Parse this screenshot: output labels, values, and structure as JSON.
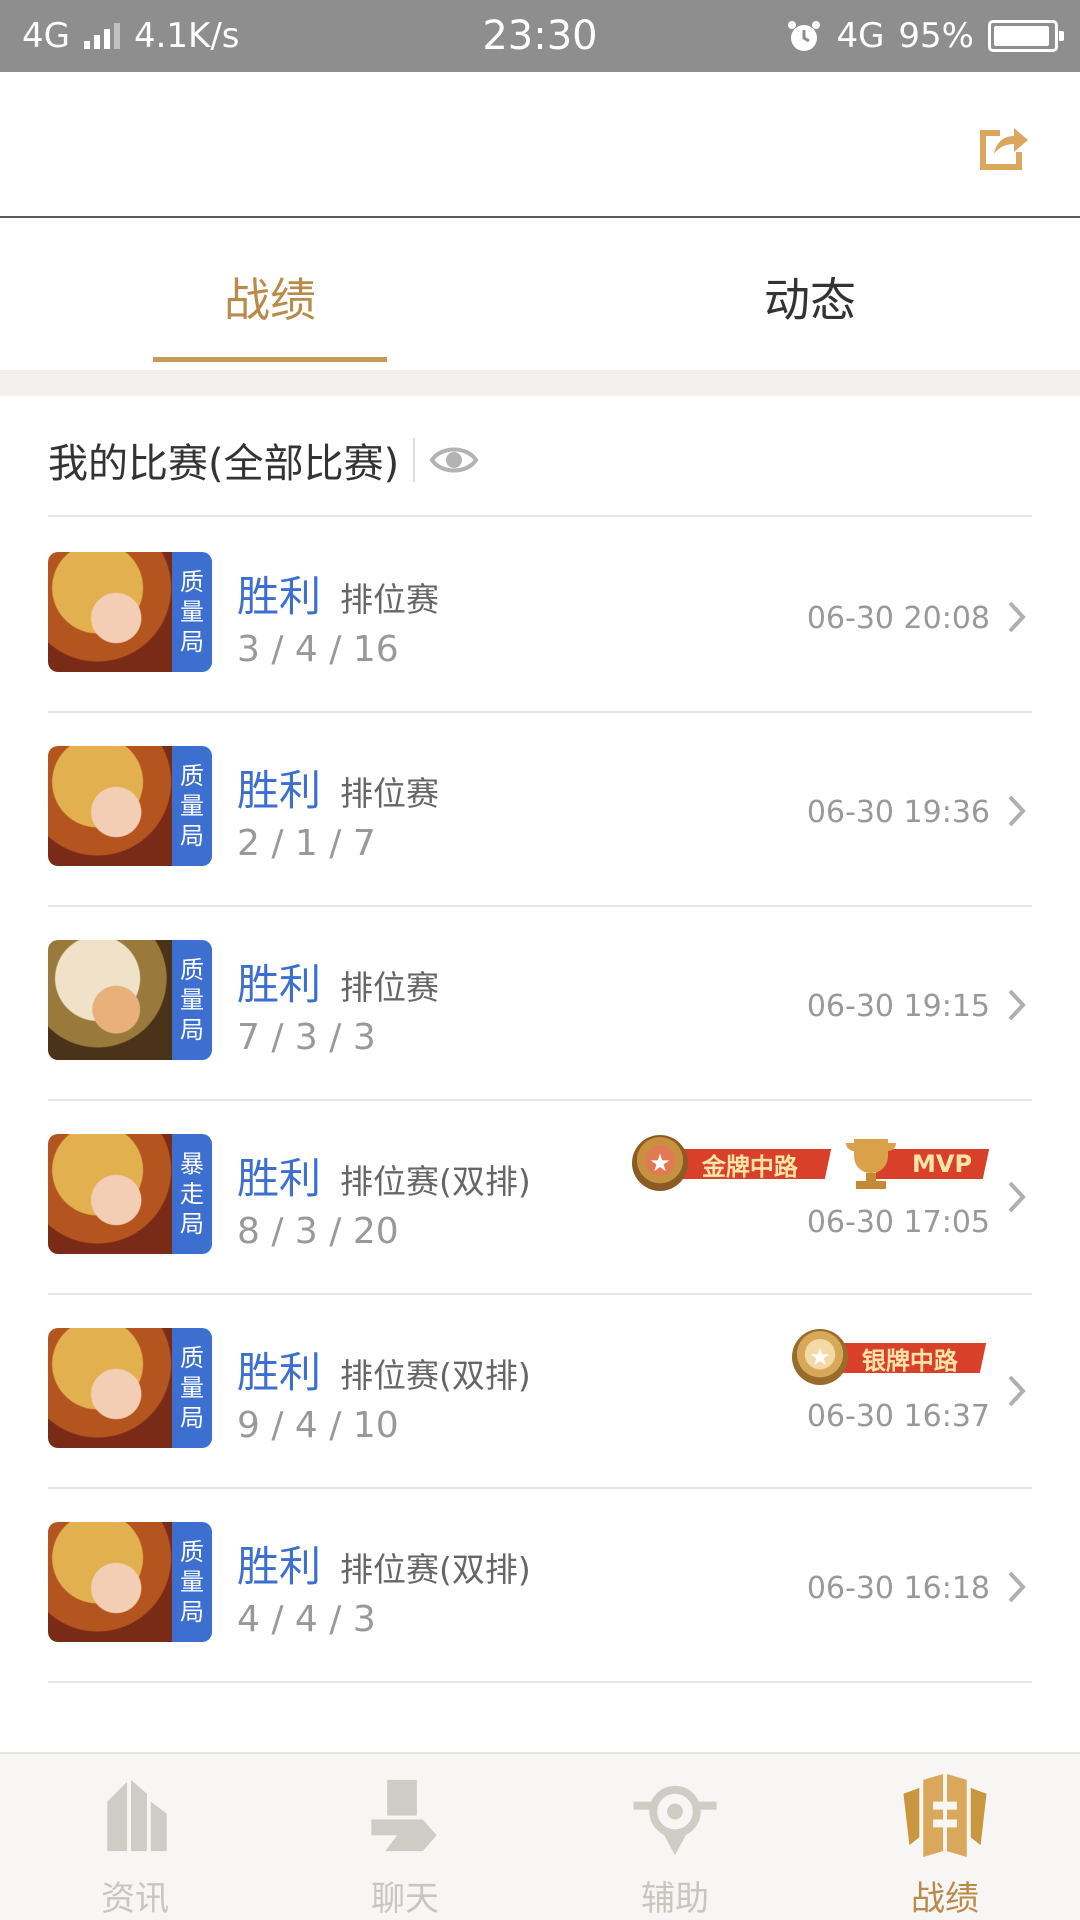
{
  "status_bar": {
    "network_left": "4G",
    "speed": "4.1K/s",
    "time": "23:30",
    "network_right": "4G",
    "battery": "95%",
    "battery_level": 0.95
  },
  "tabs": [
    {
      "label": "战绩",
      "active": true
    },
    {
      "label": "动态",
      "active": false
    }
  ],
  "section": {
    "title": "我的比赛(全部比赛)"
  },
  "matches": [
    {
      "hero_icon": "hero-girl",
      "tag": [
        "质",
        "量",
        "局"
      ],
      "result": "胜利",
      "mode": "排位赛",
      "kda": "3 / 4 / 16",
      "time": "06-30 20:08",
      "badges": []
    },
    {
      "hero_icon": "hero-girl",
      "tag": [
        "质",
        "量",
        "局"
      ],
      "result": "胜利",
      "mode": "排位赛",
      "kda": "2 / 1 / 7",
      "time": "06-30 19:36",
      "badges": []
    },
    {
      "hero_icon": "hero-warrior",
      "tag": [
        "质",
        "量",
        "局"
      ],
      "result": "胜利",
      "mode": "排位赛",
      "kda": "7 / 3 / 3",
      "time": "06-30 19:15",
      "badges": []
    },
    {
      "hero_icon": "hero-girl",
      "tag": [
        "暴",
        "走",
        "局"
      ],
      "result": "胜利",
      "mode": "排位赛(双排)",
      "kda": "8 / 3 / 20",
      "time": "06-30 17:05",
      "badges": [
        "金牌中路",
        "MVP"
      ]
    },
    {
      "hero_icon": "hero-girl",
      "tag": [
        "质",
        "量",
        "局"
      ],
      "result": "胜利",
      "mode": "排位赛(双排)",
      "kda": "9 / 4 / 10",
      "time": "06-30 16:37",
      "badges": [
        "银牌中路"
      ]
    },
    {
      "hero_icon": "hero-girl",
      "tag": [
        "质",
        "量",
        "局"
      ],
      "result": "胜利",
      "mode": "排位赛(双排)",
      "kda": "4 / 4 / 3",
      "time": "06-30 16:18",
      "badges": []
    }
  ],
  "bottom_nav": [
    {
      "label": "资讯",
      "icon": "news-icon",
      "active": false
    },
    {
      "label": "聊天",
      "icon": "chat-icon",
      "active": false
    },
    {
      "label": "辅助",
      "icon": "assist-icon",
      "active": false
    },
    {
      "label": "战绩",
      "icon": "record-icon",
      "active": true
    }
  ],
  "colors": {
    "accent": "#b98a49",
    "win_blue": "#3d6fd1",
    "status_bar": "#8e8e8e"
  }
}
